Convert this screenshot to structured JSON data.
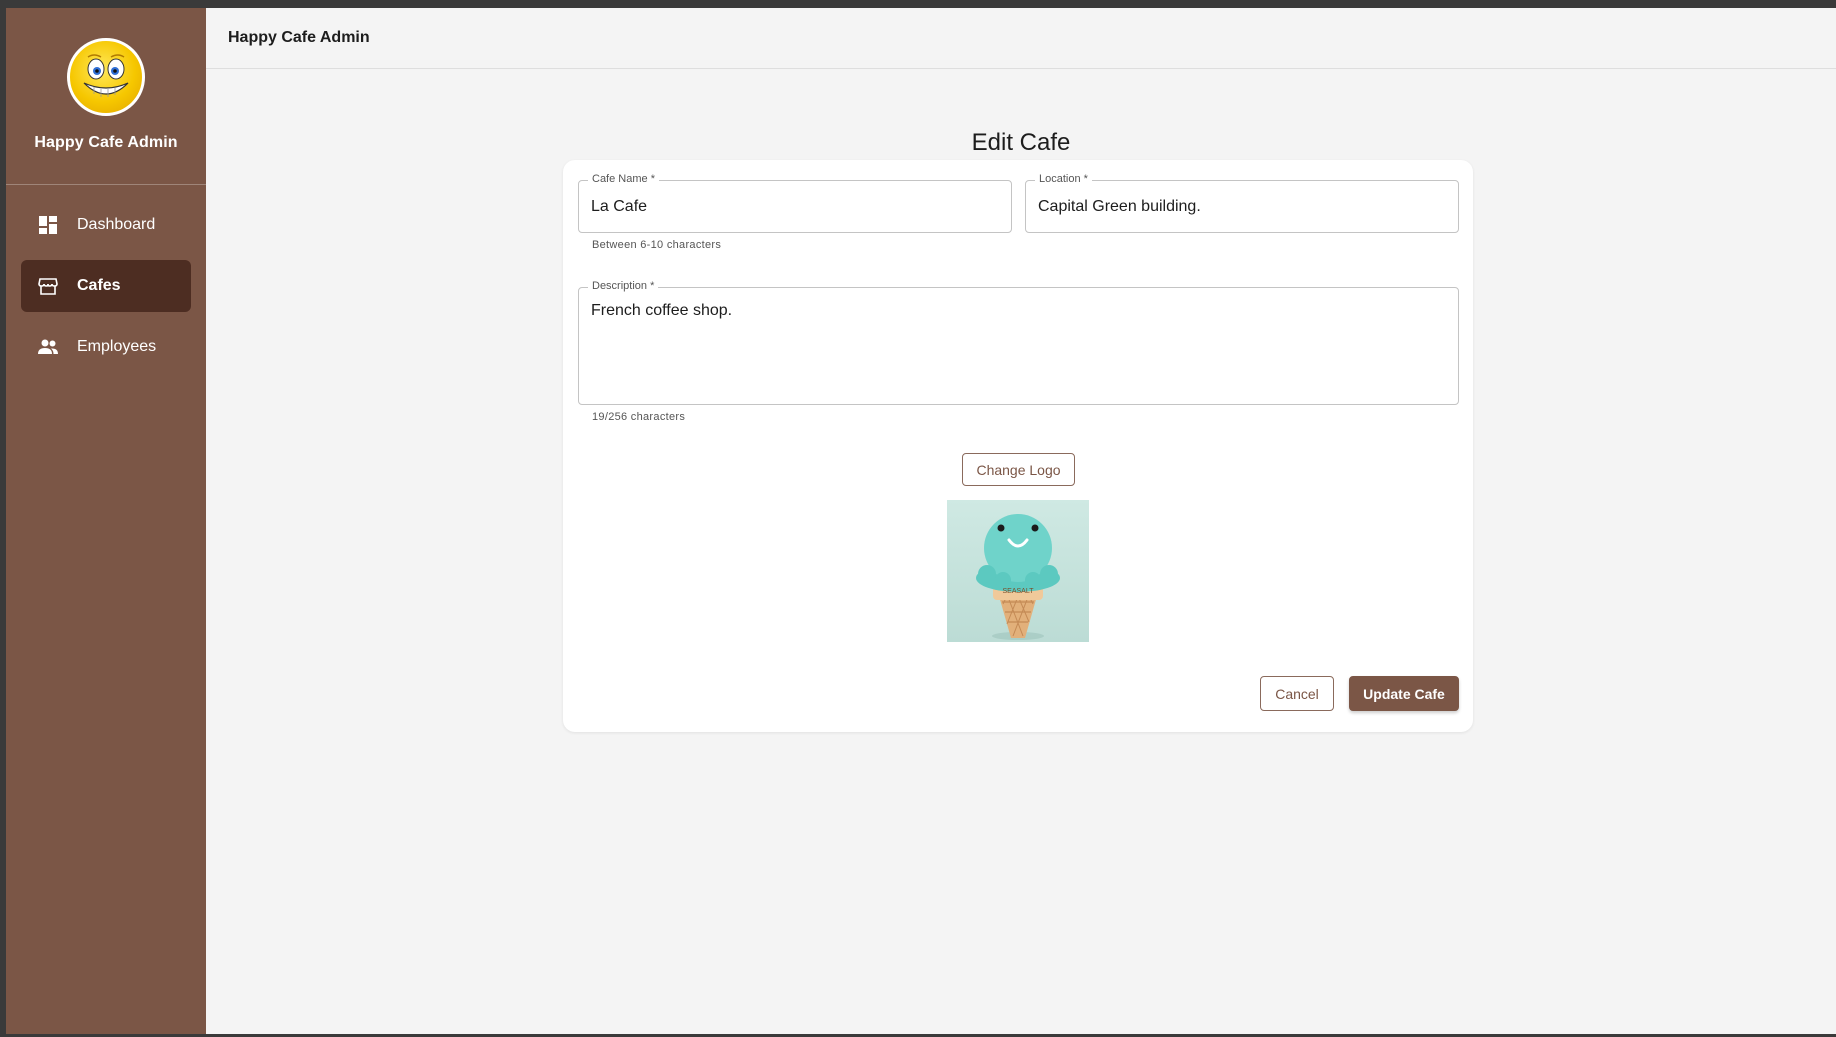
{
  "app": {
    "brand_title": "Happy Cafe Admin",
    "topbar_title": "Happy Cafe Admin"
  },
  "sidebar": {
    "items": [
      {
        "label": "Dashboard",
        "icon": "dashboard-icon",
        "active": false
      },
      {
        "label": "Cafes",
        "icon": "storefront-icon",
        "active": true
      },
      {
        "label": "Employees",
        "icon": "people-icon",
        "active": false
      }
    ]
  },
  "form": {
    "title": "Edit Cafe",
    "cafe_name": {
      "label": "Cafe Name *",
      "value": "La Cafe",
      "helper": "Between 6-10 characters"
    },
    "location": {
      "label": "Location *",
      "value": "Capital Green building."
    },
    "description": {
      "label": "Description *",
      "value": "French coffee shop.",
      "helper": "19/256 characters"
    },
    "change_logo_label": "Change Logo",
    "logo_cone_text": "SEASALT",
    "cancel_label": "Cancel",
    "submit_label": "Update Cafe"
  },
  "colors": {
    "sidebar": "#7b5646",
    "sidebar_active": "#4d2d22",
    "accent": "#7b5646",
    "background": "#f4f4f4"
  }
}
